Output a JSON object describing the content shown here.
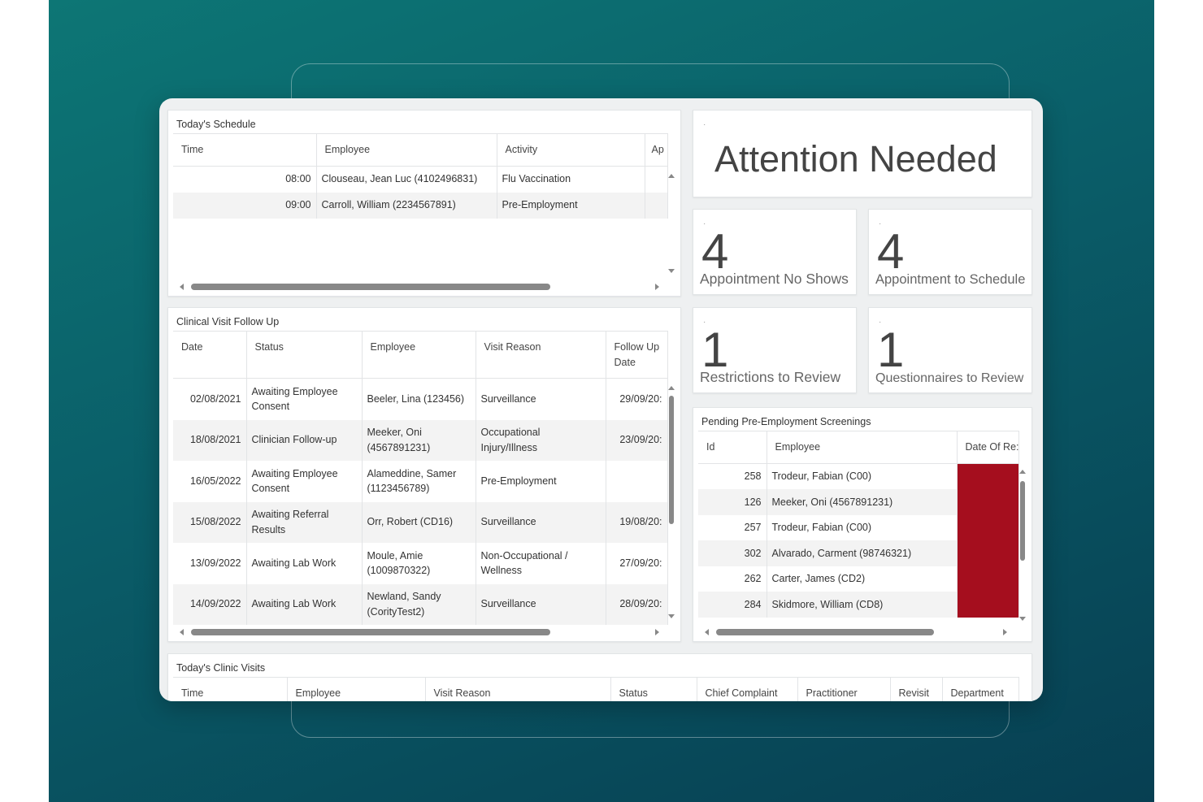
{
  "todays_schedule": {
    "title": "Today's Schedule",
    "columns": [
      "Time",
      "Employee",
      "Activity",
      "Ap"
    ],
    "rows": [
      {
        "time": "08:00",
        "employee": "Clouseau, Jean Luc (4102496831)",
        "activity": "Flu Vaccination",
        "ap": ""
      },
      {
        "time": "09:00",
        "employee": "Carroll, William (2234567891)",
        "activity": "Pre-Employment",
        "ap": ""
      }
    ]
  },
  "attention": {
    "title": "Attention Needed"
  },
  "tiles": [
    {
      "dot": "·",
      "value": "4",
      "label": "Appointment No Shows"
    },
    {
      "dot": "·",
      "value": "4",
      "label": "Appointment to Schedule"
    },
    {
      "dot": "·",
      "value": "1",
      "label": "Restrictions to Review"
    },
    {
      "dot": "·",
      "value": "1",
      "label": "Questionnaires to Review"
    }
  ],
  "clinical_followup": {
    "title": "Clinical Visit Follow Up",
    "columns": [
      "Date",
      "Status",
      "Employee",
      "Visit Reason",
      "Follow Up",
      "Date"
    ],
    "rows": [
      {
        "date": "02/08/2021",
        "status1": "Awaiting Employee",
        "status2": "Consent",
        "emp1": "Beeler, Lina (123456)",
        "emp2": "",
        "reason1": "Surveillance",
        "reason2": "",
        "follow": "29/09/20:"
      },
      {
        "date": "18/08/2021",
        "status1": "Clinician Follow-up",
        "status2": "",
        "emp1": "Meeker, Oni",
        "emp2": "(4567891231)",
        "reason1": "Occupational",
        "reason2": "Injury/Illness",
        "follow": "23/09/20:"
      },
      {
        "date": "16/05/2022",
        "status1": "Awaiting Employee",
        "status2": "Consent",
        "emp1": "Alameddine, Samer",
        "emp2": "(1123456789)",
        "reason1": "Pre-Employment",
        "reason2": "",
        "follow": ""
      },
      {
        "date": "15/08/2022",
        "status1": "Awaiting Referral",
        "status2": "Results",
        "emp1": "Orr, Robert (CD16)",
        "emp2": "",
        "reason1": "Surveillance",
        "reason2": "",
        "follow": "19/08/20:"
      },
      {
        "date": "13/09/2022",
        "status1": "Awaiting Lab Work",
        "status2": "",
        "emp1": "Moule, Amie",
        "emp2": "(1009870322)",
        "reason1": "Non-Occupational /",
        "reason2": "Wellness",
        "follow": "27/09/20:"
      },
      {
        "date": "14/09/2022",
        "status1": "Awaiting Lab Work",
        "status2": "",
        "emp1": "Newland, Sandy",
        "emp2": "(CorityTest2)",
        "reason1": "Surveillance",
        "reason2": "",
        "follow": "28/09/20:"
      }
    ]
  },
  "pending_screenings": {
    "title": "Pending Pre-Employment Screenings",
    "columns": [
      "Id",
      "Employee",
      "Date Of Re:"
    ],
    "rows": [
      {
        "id": "258",
        "employee": "Trodeur, Fabian (C00)"
      },
      {
        "id": "126",
        "employee": "Meeker, Oni (4567891231)"
      },
      {
        "id": "257",
        "employee": "Trodeur, Fabian (C00)"
      },
      {
        "id": "302",
        "employee": "Alvarado, Carment (98746321)"
      },
      {
        "id": "262",
        "employee": "Carter, James (CD2)"
      },
      {
        "id": "284",
        "employee": "Skidmore, William (CD8)"
      }
    ],
    "highlight_color": "#a50e1e"
  },
  "clinic_visits": {
    "title": "Today's Clinic Visits",
    "columns": [
      "Time",
      "Employee",
      "Visit Reason",
      "Status",
      "Chief Complaint",
      "Practitioner",
      "Revisit",
      "Department"
    ]
  }
}
